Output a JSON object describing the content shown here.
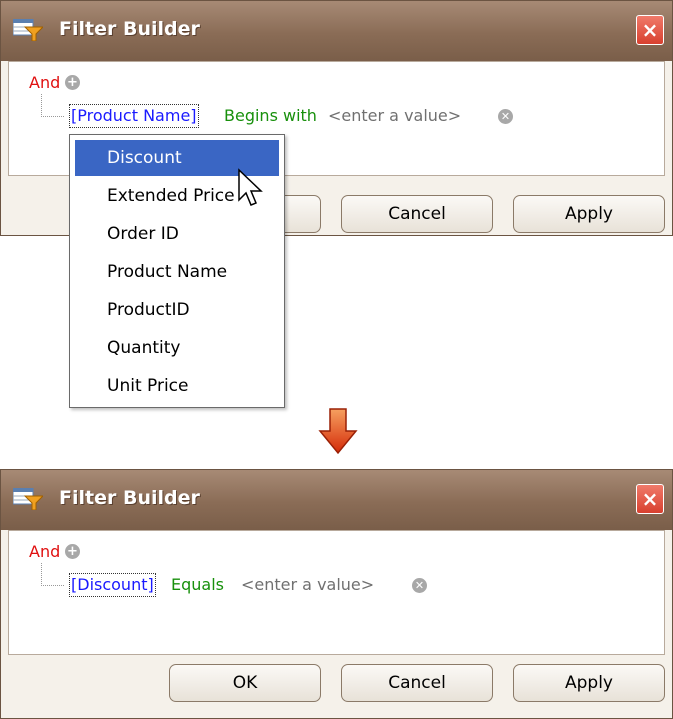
{
  "dialog_before": {
    "title": "Filter Builder",
    "close_glyph": "×",
    "group_operator": "And",
    "condition": {
      "field": "[Product Name]",
      "operator": "Begins with",
      "value_placeholder": "<enter a value>"
    },
    "buttons": {
      "cancel": "Cancel",
      "apply": "Apply"
    }
  },
  "field_menu": {
    "items": [
      "Discount",
      "Extended Price",
      "Order ID",
      "Product Name",
      "ProductID",
      "Quantity",
      "Unit Price"
    ],
    "selected": "Discount"
  },
  "dialog_after": {
    "title": "Filter Builder",
    "close_glyph": "×",
    "group_operator": "And",
    "condition": {
      "field": "[Discount]",
      "operator": "Equals",
      "value_placeholder": "<enter a value>"
    },
    "buttons": {
      "ok": "OK",
      "cancel": "Cancel",
      "apply": "Apply"
    }
  },
  "icons": {
    "add": "plus-circle-icon",
    "remove": "remove-circle-icon",
    "transition": "down-arrow-icon",
    "app": "filter-builder-app-icon"
  },
  "colors": {
    "title_bar": "#8a6c56",
    "group_operator": "#e01010",
    "field": "#1a1aff",
    "operator": "#18900c",
    "placeholder": "#707070",
    "menu_selection": "#3a66c4",
    "close_button": "#d8402f",
    "arrow": "#e23a10"
  }
}
